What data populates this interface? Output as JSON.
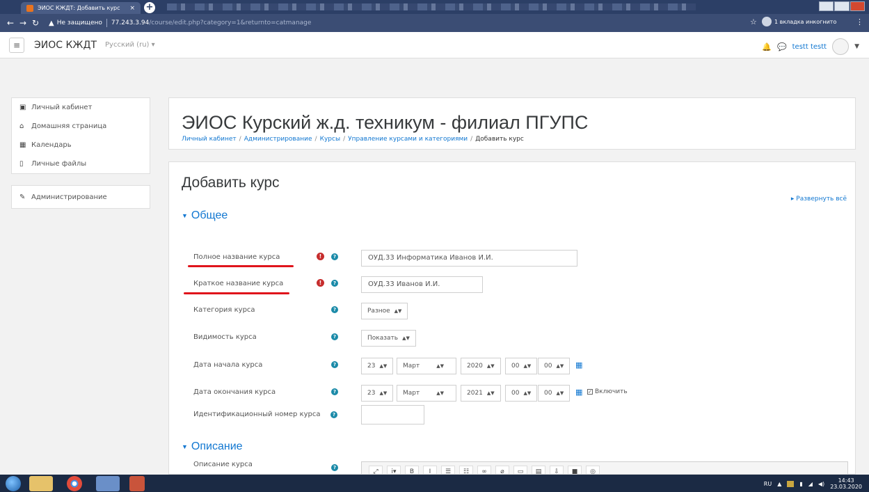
{
  "browser": {
    "tab_title": "ЭИОС КЖДТ: Добавить курс",
    "tab_close": "×",
    "new_tab": "+",
    "not_secure": "Не защищено",
    "url_host": "77.243.3.94",
    "url_path": "/course/edit.php?category=1&returnto=catmanage",
    "incognito_label": "1 вкладка инкогнито"
  },
  "navbar": {
    "site_name": "ЭИОС КЖДТ",
    "language": "Русский (ru) ▾",
    "user_name": "testt testt"
  },
  "drawer": {
    "items": [
      {
        "label": "Личный кабинет",
        "icon": "dashboard-icon"
      },
      {
        "label": "Домашняя страница",
        "icon": "home-icon"
      },
      {
        "label": "Календарь",
        "icon": "calendar-icon"
      },
      {
        "label": "Личные файлы",
        "icon": "file-icon"
      }
    ],
    "admin": {
      "label": "Администрирование",
      "icon": "wrench-icon"
    }
  },
  "header": {
    "title": "ЭИОС Курский ж.д. техникум - филиал ПГУПС",
    "breadcrumb": [
      "Личный кабинет",
      "Администрирование",
      "Курсы",
      "Управление курсами и категориями",
      "Добавить курс"
    ]
  },
  "form": {
    "title": "Добавить курс",
    "expand_all": "Развернуть всё",
    "section_general": "Общее",
    "section_description": "Описание",
    "fullname_label": "Полное название курса",
    "fullname_value": "ОУД.33 Информатика Иванов И.И.",
    "shortname_label": "Краткое название курса",
    "shortname_value": "ОУД.33 Иванов И.И.",
    "category_label": "Категория курса",
    "category_value": "Разное",
    "visibility_label": "Видимость курса",
    "visibility_value": "Показать",
    "startdate_label": "Дата начала курса",
    "startdate": {
      "day": "23",
      "month": "Март",
      "year": "2020",
      "hour": "00",
      "minute": "00"
    },
    "enddate_label": "Дата окончания курса",
    "enddate": {
      "day": "23",
      "month": "Март",
      "year": "2021",
      "hour": "00",
      "minute": "00"
    },
    "enable_label": "Включить",
    "idnumber_label": "Идентификационный номер курса",
    "idnumber_value": "",
    "summary_label": "Описание курса"
  },
  "taskbar": {
    "lang": "RU",
    "time": "14:43",
    "date": "23.03.2020"
  },
  "colors": {
    "accent": "#1177d1",
    "required": "#c62d2d",
    "annotation_underline": "#e0141b"
  }
}
